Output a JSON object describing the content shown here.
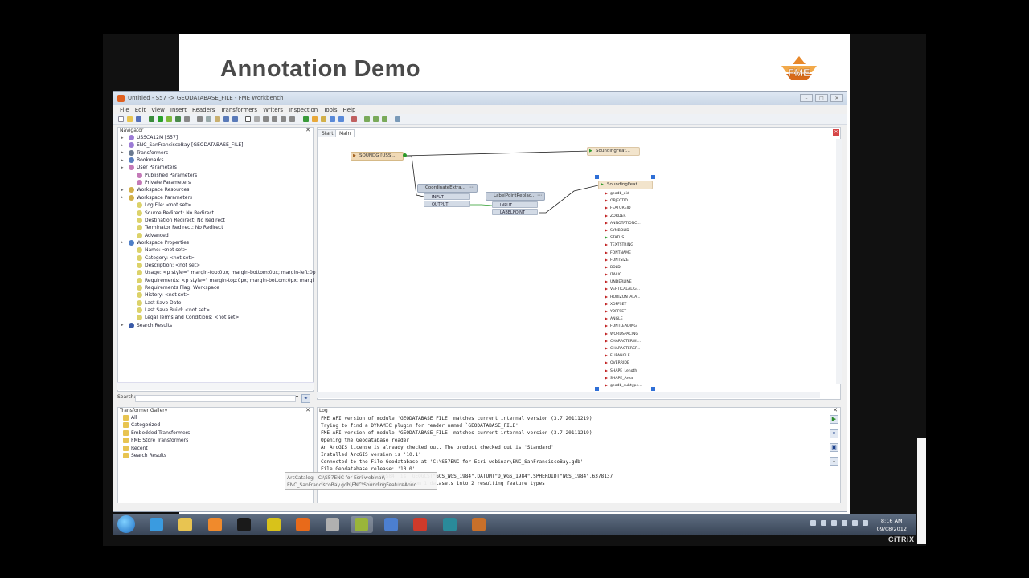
{
  "slide": {
    "title": "Annotation Demo"
  },
  "window": {
    "title": "Untitled - S57 -> GEODATABASE_FILE - FME Workbench",
    "controls": [
      "–",
      "□",
      "✕"
    ]
  },
  "menu": [
    "File",
    "Edit",
    "View",
    "Insert",
    "Readers",
    "Transformers",
    "Writers",
    "Inspection",
    "Tools",
    "Help"
  ],
  "navigator": {
    "title": "Navigator",
    "items": [
      {
        "label": "USSCA12M [S57]",
        "indent": 0,
        "icon": "reader-icon",
        "color": "#9c7bd6"
      },
      {
        "label": "ENC_SanFranciscoBay [GEODATABASE_FILE]",
        "indent": 0,
        "icon": "writer-icon",
        "color": "#9c7bd6"
      },
      {
        "label": "Transformers",
        "indent": 0,
        "icon": "transformers-icon",
        "color": "#6b7a90"
      },
      {
        "label": "Bookmarks",
        "indent": 0,
        "icon": "bookmark-icon",
        "color": "#5b7fbf"
      },
      {
        "label": "User Parameters",
        "indent": 0,
        "icon": "user-params-icon",
        "color": "#c47ab8"
      },
      {
        "label": "Published Parameters",
        "indent": 1,
        "icon": "published-params-icon",
        "color": "#c47ab8"
      },
      {
        "label": "Private Parameters",
        "indent": 1,
        "icon": "private-params-icon",
        "color": "#c47ab8"
      },
      {
        "label": "Workspace Resources",
        "indent": 0,
        "icon": "resources-icon",
        "color": "#d2b04a"
      },
      {
        "label": "Workspace Parameters",
        "indent": 0,
        "icon": "workspace-params-icon",
        "color": "#d2b04a"
      },
      {
        "label": "Log File: <not set>",
        "indent": 1,
        "icon": "param-icon",
        "color": "#dcd26a"
      },
      {
        "label": "Source Redirect: No Redirect",
        "indent": 1,
        "icon": "param-icon",
        "color": "#dcd26a"
      },
      {
        "label": "Destination Redirect: No Redirect",
        "indent": 1,
        "icon": "param-icon",
        "color": "#dcd26a"
      },
      {
        "label": "Terminator Redirect: No Redirect",
        "indent": 1,
        "icon": "param-icon",
        "color": "#dcd26a"
      },
      {
        "label": "Advanced",
        "indent": 1,
        "icon": "param-icon",
        "color": "#dcd26a"
      },
      {
        "label": "Workspace Properties",
        "indent": 0,
        "icon": "properties-icon",
        "color": "#4f7fc8"
      },
      {
        "label": "Name: <not set>",
        "indent": 1,
        "icon": "param-icon",
        "color": "#dcd26a"
      },
      {
        "label": "Category: <not set>",
        "indent": 1,
        "icon": "param-icon",
        "color": "#dcd26a"
      },
      {
        "label": "Description: <not set>",
        "indent": 1,
        "icon": "param-icon",
        "color": "#dcd26a"
      },
      {
        "label": "Usage: <p style=\" margin-top:0px; margin-bottom:0px; margin-left:0p",
        "indent": 1,
        "icon": "param-icon",
        "color": "#dcd26a"
      },
      {
        "label": "Requirements: <p style=\" margin-top:0px; margin-bottom:0px; margi",
        "indent": 1,
        "icon": "param-icon",
        "color": "#dcd26a"
      },
      {
        "label": "Requirements Flag: Workspace",
        "indent": 1,
        "icon": "param-icon",
        "color": "#dcd26a"
      },
      {
        "label": "History: <not set>",
        "indent": 1,
        "icon": "param-icon",
        "color": "#dcd26a"
      },
      {
        "label": "Last Save Date:",
        "indent": 1,
        "icon": "param-icon",
        "color": "#dcd26a"
      },
      {
        "label": "Last Save Build: <not set>",
        "indent": 1,
        "icon": "param-icon",
        "color": "#dcd26a"
      },
      {
        "label": "Legal Terms and Conditions: <not set>",
        "indent": 1,
        "icon": "param-icon",
        "color": "#dcd26a"
      },
      {
        "label": "Search Results",
        "indent": 0,
        "icon": "binoculars-icon",
        "color": "#3a5aa8"
      }
    ]
  },
  "search": {
    "label": "Search:"
  },
  "gallery": {
    "title": "Transformer Gallery",
    "items": [
      "All",
      "Categorized",
      "Embedded Transformers",
      "FME Store Transformers",
      "Recent",
      "Search Results"
    ]
  },
  "canvas": {
    "tabs": [
      "Start",
      "Main"
    ],
    "reader": "SOUNDG [USS...",
    "writer1": "SoundingFeat...",
    "coord": {
      "name": "CoordinateExtra...",
      "in": "INPUT",
      "out": "OUTPUT"
    },
    "label": {
      "name": "LabelPointReplac...",
      "in": "INPUT",
      "out": "LABELPOINT"
    },
    "writer2": {
      "name": "SoundingFeat...",
      "attributes": [
        "geodb_oid",
        "OBJECTID",
        "FEATUREID",
        "ZORDER",
        "ANNOTATIONC...",
        "SYMBOLID",
        "STATUS",
        "TEXTSTRING",
        "FONTNAME",
        "FONTSIZE",
        "BOLD",
        "ITALIC",
        "UNDERLINE",
        "VERTICALALIG...",
        "HORIZONTALA...",
        "XOFFSET",
        "YOFFSET",
        "ANGLE",
        "FONTLEADING",
        "WORDSPACING",
        "CHARACTERWI...",
        "CHARACTERSP...",
        "FLIPANGLE",
        "OVERRIDE",
        "SHAPE_Length",
        "SHAPE_Area",
        "geodb_subtype..."
      ]
    }
  },
  "log": {
    "title": "Log",
    "lines": [
      "FME API version of module 'GEODATABASE_FILE' matches current internal version (3.7 20111219)",
      "Trying to find a DYNAMIC plugin for reader named `GEODATABASE_FILE'",
      "FME API version of module 'GEODATABASE_FILE' matches current internal version (3.7 20111219)",
      "Opening the Geodatabase reader",
      "An ArcGIS license is already checked out. The product checked out is 'Standard'",
      "Installed ArcGIS version is '10.1'",
      "Connected to the File Geodatabase at 'C:\\S57ENC for Esri webinar\\ENC_SanFranciscoBay.gdb'",
      "File Geodatabase release: '10.0'",
      "                                 ordinate system `LL-WGS84' is `GEOGCS[\"GCS_WGS_1984\",DATUM[\"D_WGS_1984\",SPHEROID[\"WGS_1984\",6378137",
      "Merged 2 schema features read from 1 datasets into 2 resulting feature types"
    ]
  },
  "tooltip": {
    "line1": "ArcCatalog - C:\\S57ENC for Esri webinar\\",
    "line2": "ENC_SanFranciscoBay.gdb\\ENC\\SoundingFeatureAnno"
  },
  "taskbar": {
    "clock_time": "8:16 AM",
    "clock_date": "09/08/2012",
    "apps": [
      {
        "name": "ie-icon",
        "color": "#3a9be0"
      },
      {
        "name": "explorer-icon",
        "color": "#e8c451"
      },
      {
        "name": "media-player-icon",
        "color": "#f08a2c"
      },
      {
        "name": "cmd-icon",
        "color": "#1a1a1a"
      },
      {
        "name": "app-yellow-icon",
        "color": "#d8c21a"
      },
      {
        "name": "firefox-icon",
        "color": "#e86a1a"
      },
      {
        "name": "tools-icon",
        "color": "#b0b0b0"
      },
      {
        "name": "arccatalog-icon",
        "color": "#9ab53a"
      },
      {
        "name": "settings-icon",
        "color": "#4c7fd0"
      },
      {
        "name": "acrobat-icon",
        "color": "#d03a2a"
      },
      {
        "name": "globe-icon",
        "color": "#2a8a9a"
      },
      {
        "name": "fme-icon",
        "color": "#c8702a"
      }
    ]
  },
  "branding": {
    "citrix": "CiTRiX"
  },
  "colors": {
    "accent": "#2f6fd6",
    "link_line": "#2a9a2a"
  }
}
